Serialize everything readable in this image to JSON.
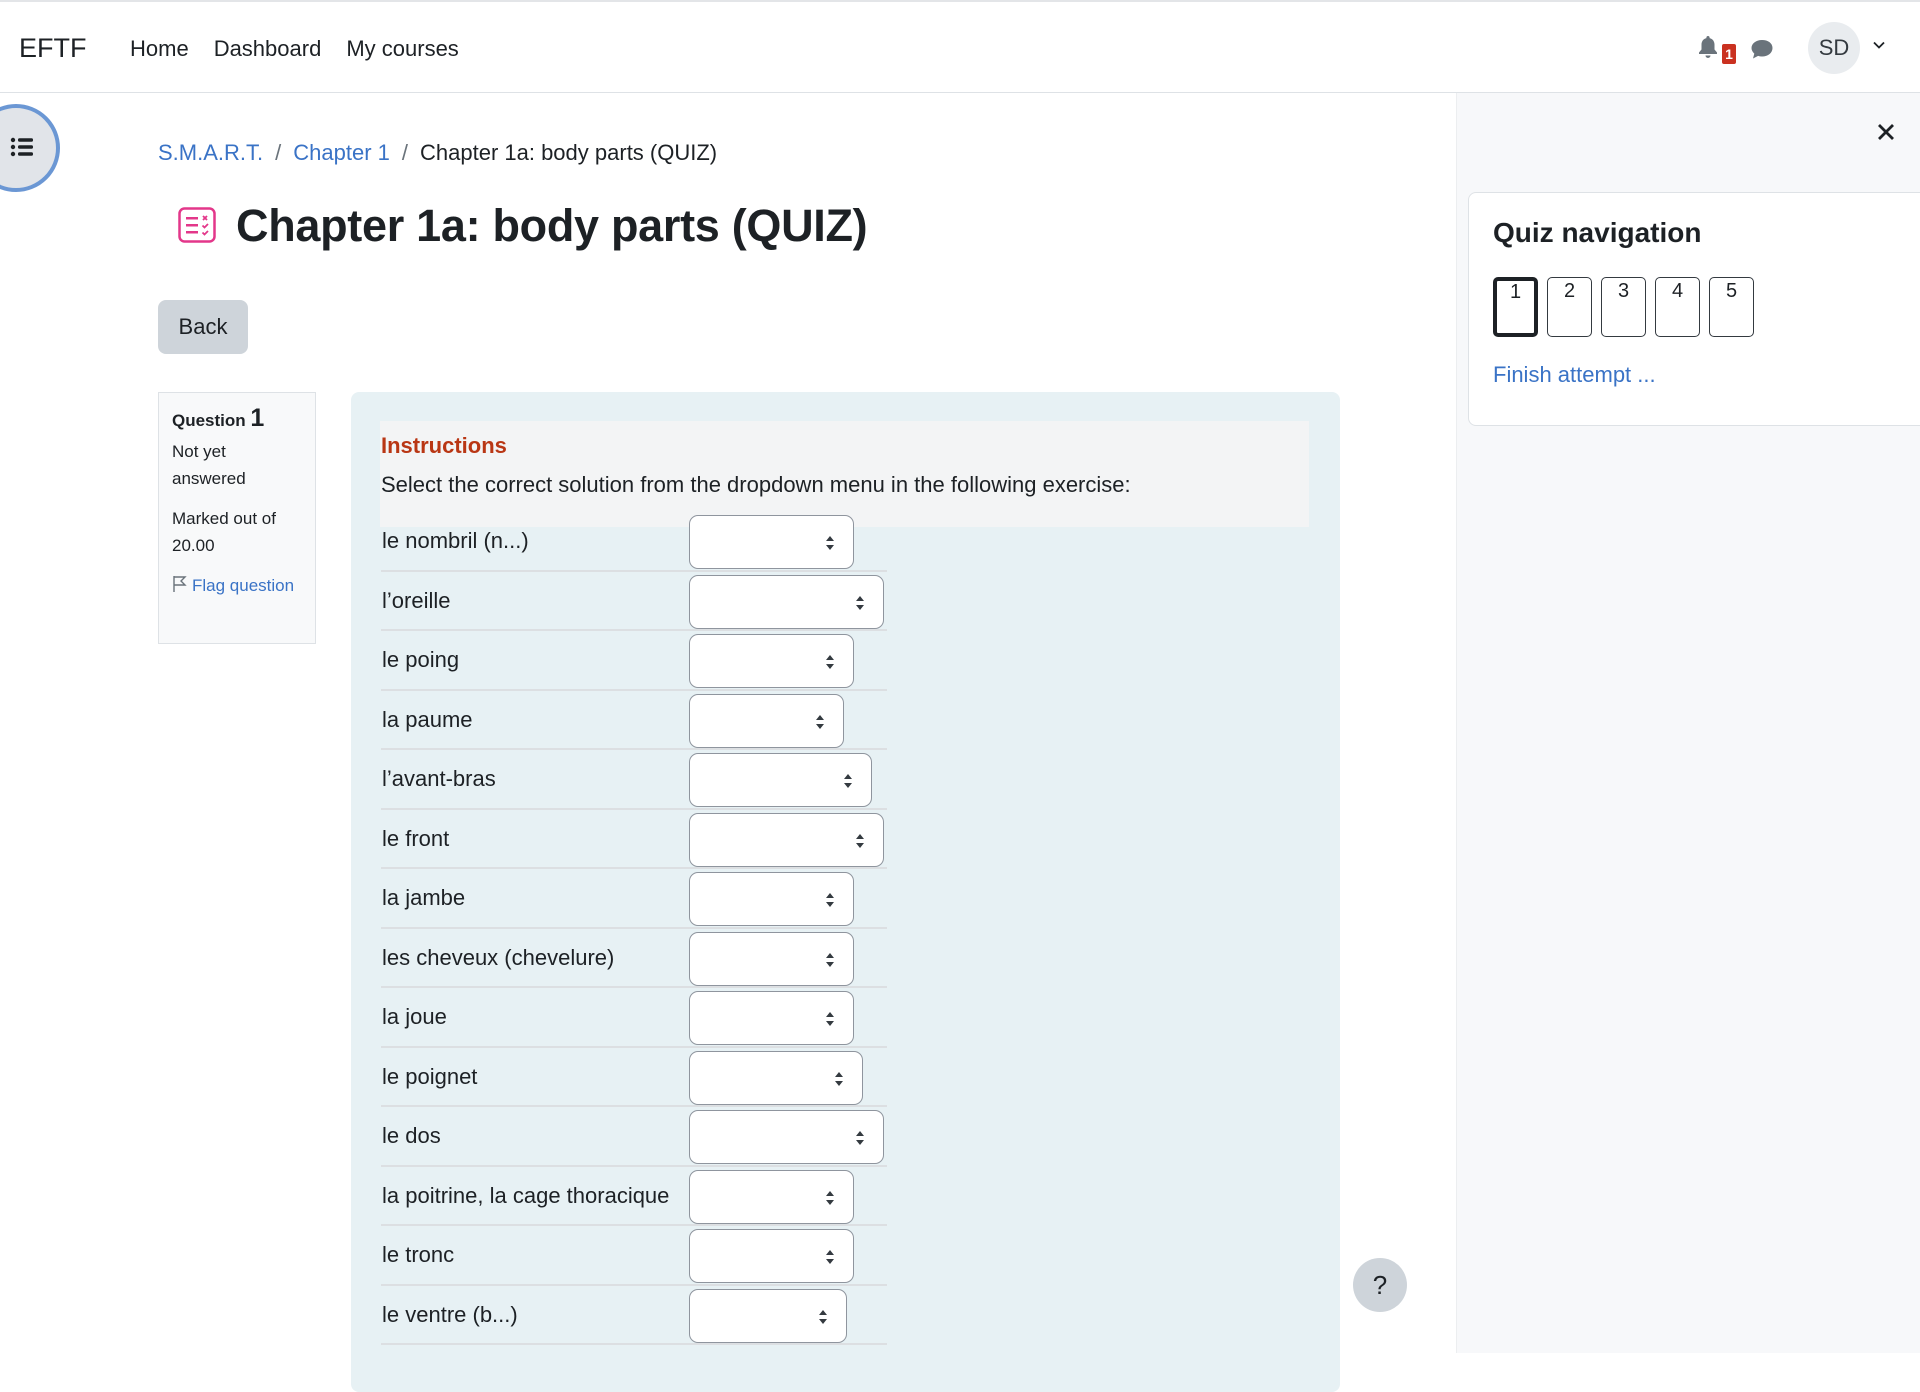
{
  "header": {
    "brand": "EFTF",
    "nav": [
      "Home",
      "Dashboard",
      "My courses"
    ],
    "notifications_count": "1",
    "user_initials": "SD"
  },
  "breadcrumb": {
    "items": [
      "S.M.A.R.T.",
      "Chapter 1",
      "Chapter 1a: body parts (QUIZ)"
    ],
    "separator": "/"
  },
  "page": {
    "title": "Chapter 1a: body parts (QUIZ)",
    "back_label": "Back",
    "icon": "quiz-icon",
    "accent_color": "#e3378a"
  },
  "question_info": {
    "label": "Question",
    "number": "1",
    "state": "Not yet answered",
    "grade": "Marked out of 20.00",
    "flag_label": "Flag question"
  },
  "instructions": {
    "heading": "Instructions",
    "text": "Select the correct solution from the dropdown menu in the following exercise:"
  },
  "rows": [
    {
      "label": "le nombril (n...)",
      "value": ""
    },
    {
      "label": "l’oreille",
      "value": ""
    },
    {
      "label": "le poing",
      "value": ""
    },
    {
      "label": "la paume",
      "value": ""
    },
    {
      "label": "l’avant-bras",
      "value": ""
    },
    {
      "label": "le front",
      "value": ""
    },
    {
      "label": "la jambe",
      "value": ""
    },
    {
      "label": "les cheveux (chevelure)",
      "value": ""
    },
    {
      "label": "la joue",
      "value": ""
    },
    {
      "label": "le poignet",
      "value": ""
    },
    {
      "label": "le dos",
      "value": ""
    },
    {
      "label": "la poitrine, la cage thoracique",
      "value": ""
    },
    {
      "label": "le tronc",
      "value": ""
    },
    {
      "label": "le ventre (b...)",
      "value": ""
    }
  ],
  "help_label": "?",
  "quiz_navigation": {
    "title": "Quiz navigation",
    "questions": [
      "1",
      "2",
      "3",
      "4",
      "5"
    ],
    "current": "1",
    "finish_label": "Finish attempt ..."
  }
}
